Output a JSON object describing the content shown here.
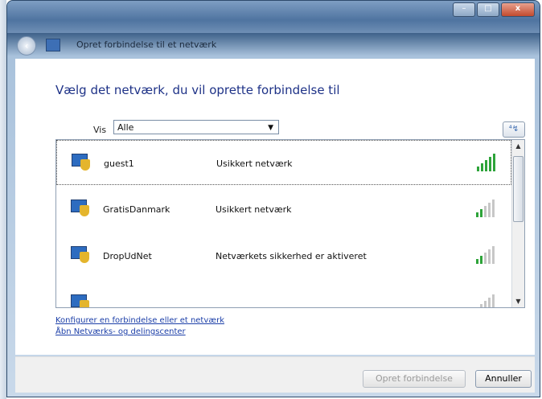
{
  "window": {
    "title": "Opret forbindelse til et netværk"
  },
  "caption": {
    "minimize": "–",
    "maximize": "□",
    "close": "x"
  },
  "nav": {
    "back": "‹"
  },
  "main": {
    "heading": "Vælg det netværk, du vil oprette forbindelse til",
    "filter_label": "Vis",
    "filter_value": "Alle",
    "refresh_icon": "⁴↯"
  },
  "networks": [
    {
      "name": "guest1",
      "status": "Usikkert netværk",
      "signal_level": 5,
      "selected": true
    },
    {
      "name": "GratisDanmark",
      "status": "Usikkert netværk",
      "signal_level": 2,
      "selected": false
    },
    {
      "name": "DropUdNet",
      "status": "Netværkets sikkerhed er aktiveret",
      "signal_level": 2,
      "selected": false
    },
    {
      "name": "",
      "status": "",
      "signal_level": 1,
      "selected": false
    }
  ],
  "links": {
    "configure": "Konfigurer en forbindelse eller et netværk",
    "open_center": "Åbn Netværks- og delingscenter"
  },
  "buttons": {
    "connect": "Opret forbindelse",
    "cancel": "Annuller"
  },
  "colors": {
    "signal_on": "#2ea43a",
    "signal_off": "#c7c7c7",
    "heading": "#1e3287",
    "link": "#1c3fa8"
  }
}
